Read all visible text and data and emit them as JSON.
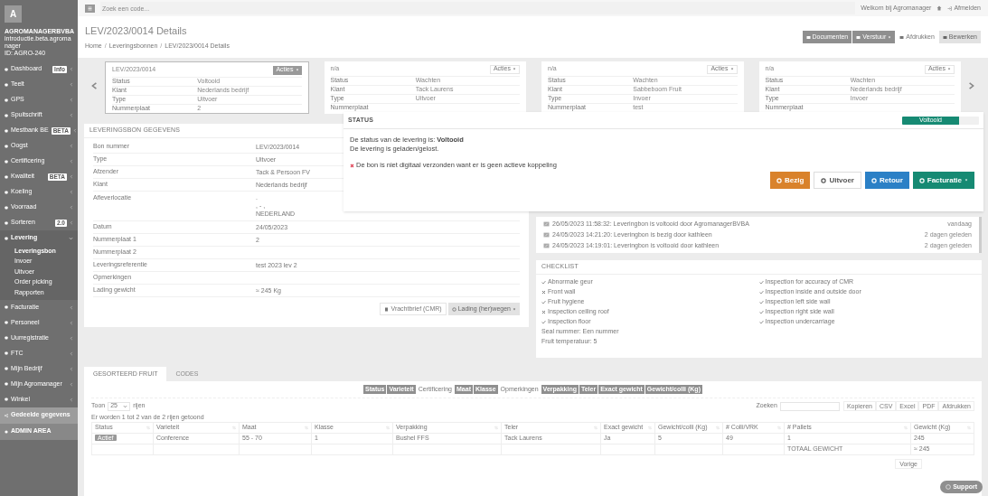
{
  "topbar": {
    "search_placeholder": "Zoek een code...",
    "welcome": "Welkom bij Agromanager",
    "logout": "Afmelden"
  },
  "sidebar": {
    "logo": "A",
    "company": "AGROMANAGERBVBA",
    "subtitle": "introductie.beta.agromanager",
    "id": "ID: AGRO-240",
    "items": [
      {
        "label": "Dashboard",
        "badge": "Info",
        "kind": "item",
        "expanded": false
      },
      {
        "label": "Teelt",
        "kind": "item",
        "expanded": false
      },
      {
        "label": "GPS",
        "kind": "item",
        "expanded": false
      },
      {
        "label": "Spuitschrift",
        "kind": "item",
        "expanded": false
      },
      {
        "label": "Mestbank BE",
        "badge": "BETA",
        "kind": "item",
        "expanded": false
      },
      {
        "label": "Oogst",
        "kind": "item",
        "expanded": false
      },
      {
        "label": "Certificering",
        "kind": "item",
        "expanded": false
      },
      {
        "label": "Kwaliteit",
        "badge": "BETA",
        "kind": "item",
        "expanded": false
      },
      {
        "label": "Koeling",
        "kind": "item",
        "expanded": false
      },
      {
        "label": "Voorraad",
        "kind": "item",
        "expanded": false
      },
      {
        "label": "Sorteren",
        "badge": "2.0",
        "kind": "item",
        "expanded": false
      },
      {
        "label": "Levering",
        "kind": "item",
        "expanded": true,
        "children": [
          {
            "label": "Leveringsbon",
            "selected": true
          },
          {
            "label": "Invoer",
            "selected": false
          },
          {
            "label": "Uitvoer",
            "selected": false
          },
          {
            "label": "Order picking",
            "selected": false
          },
          {
            "label": "Rapporten",
            "selected": false
          }
        ]
      },
      {
        "label": "Facturatie",
        "kind": "item",
        "expanded": false
      },
      {
        "label": "Personeel",
        "kind": "item",
        "expanded": false
      },
      {
        "label": "Uurregistratie",
        "kind": "item",
        "expanded": false
      },
      {
        "label": "FTC",
        "kind": "item",
        "expanded": false
      },
      {
        "label": "Mijn Bedrijf",
        "kind": "item",
        "expanded": false
      },
      {
        "label": "Mijn Agromanager",
        "kind": "item",
        "expanded": false
      },
      {
        "label": "Winkel",
        "kind": "item",
        "expanded": false
      },
      {
        "label": "Gedeelde gegevens",
        "kind": "shared"
      },
      {
        "label": "ADMIN AREA",
        "kind": "admin"
      }
    ]
  },
  "header": {
    "title": "LEV/2023/0014 Details",
    "breadcrumb": [
      "Home",
      "Leveringsbonnen",
      "LEV/2023/0014 Details"
    ],
    "breadcrumb_separator": "/",
    "buttons": [
      {
        "label": "Documenten",
        "kind": "dark",
        "disabled": false
      },
      {
        "label": "Verstuur",
        "kind": "dark",
        "disabled": false,
        "caret": true
      },
      {
        "label": "Afdrukken",
        "kind": "plain",
        "disabled": false
      },
      {
        "label": "Bewerken",
        "kind": "dark",
        "disabled": true
      }
    ]
  },
  "cards": [
    {
      "title": "LEV/2023/0014",
      "selected": true,
      "actions": "Acties",
      "rows": [
        [
          "Status",
          "Voltooid"
        ],
        [
          "Klant",
          "Nederlands bedrijf"
        ],
        [
          "Type",
          "Uitvoer"
        ],
        [
          "Nummerplaat",
          "2"
        ]
      ]
    },
    {
      "title": "n/a",
      "selected": false,
      "actions": "Acties",
      "rows": [
        [
          "Status",
          "Wachten"
        ],
        [
          "Klant",
          "Tack Laurens"
        ],
        [
          "Type",
          "Uitvoer"
        ],
        [
          "Nummerplaat",
          ""
        ]
      ]
    },
    {
      "title": "n/a",
      "selected": false,
      "actions": "Acties",
      "rows": [
        [
          "Status",
          "Wachten"
        ],
        [
          "Klant",
          "Sabbeboom Fruit"
        ],
        [
          "Type",
          "Invoer"
        ],
        [
          "Nummerplaat",
          "test"
        ]
      ]
    },
    {
      "title": "n/a",
      "selected": false,
      "actions": "Acties",
      "rows": [
        [
          "Status",
          "Wachten"
        ],
        [
          "Klant",
          "Nederlands bedrijf"
        ],
        [
          "Type",
          "Invoer"
        ],
        [
          "Nummerplaat",
          ""
        ]
      ]
    }
  ],
  "details": {
    "title": "LEVERINGSBON GEGEVENS",
    "rows": [
      [
        "Bon nummer",
        "LEV/2023/0014"
      ],
      [
        "Type",
        "Uitvoer"
      ],
      [
        "Afzender",
        "Tack & Persoon FV"
      ],
      [
        "Klant",
        "Nederlands bedrijf"
      ],
      [
        "Afleverlocatie",
        ".\n, - ,\nNEDERLAND"
      ],
      [
        "Datum",
        "24/05/2023"
      ],
      [
        "Nummerplaat 1",
        "2"
      ],
      [
        "Nummerplaat 2",
        ""
      ],
      [
        "Leveringsreferentie",
        "test 2023 lev 2"
      ],
      [
        "Opmerkingen",
        ""
      ],
      [
        "Lading gewicht",
        "≈ 245 Kg"
      ]
    ],
    "buttons": [
      {
        "label": "Vrachtbrief (CMR)",
        "disabled": false
      },
      {
        "label": "Lading (her)wegen",
        "disabled": true
      }
    ]
  },
  "status": {
    "title": "STATUS",
    "progress": {
      "label": "Voltooid",
      "level": 0.74
    },
    "line1": "De status van de levering is: **Voltooid**",
    "line2": "De levering is geladen/gelost.",
    "warning": "De bon is niet digitaal verzonden want er is geen actieve koppeling",
    "buttons": [
      {
        "label": "Bezig",
        "kind": "warning"
      },
      {
        "label": "Uitvoer",
        "kind": "plain"
      },
      {
        "label": "Retour",
        "kind": "primary"
      },
      {
        "label": "Facturatie",
        "kind": "success",
        "caret": true
      }
    ]
  },
  "activity": [
    {
      "text": "26/05/2023 11:58:32: Leveringbon is voltooid door AgromanagerBVBA",
      "when": "vandaag"
    },
    {
      "text": "24/05/2023 14:21:20: Leveringbon is bezig door kathleen",
      "when": "2 dagen geleden"
    },
    {
      "text": "24/05/2023 14:19:01: Leveringbon is voltooid door kathleen",
      "when": "2 dagen geleden"
    }
  ],
  "checklist": {
    "title": "CHECKLIST",
    "left": [
      {
        "label": "Abnormale geur",
        "ok": true
      },
      {
        "label": "Front wall",
        "ok": false
      },
      {
        "label": "Fruit hygiene",
        "ok": true
      },
      {
        "label": "Inspection ceiling roof",
        "ok": false
      },
      {
        "label": "Inspection floor",
        "ok": true
      }
    ],
    "right": [
      {
        "label": "Inspection for accuracy of CMR",
        "ok": true
      },
      {
        "label": "Inspection inside and outside door",
        "ok": true
      },
      {
        "label": "Inspection left side wall",
        "ok": true
      },
      {
        "label": "Inspection right side wall",
        "ok": true
      },
      {
        "label": "Inspection undercarriage",
        "ok": true
      }
    ],
    "notes": [
      "Seal nummer: Een nummer",
      "Fruit temperatuur: 5"
    ]
  },
  "bottom": {
    "tabs": [
      {
        "label": "GESORTEERD FRUIT",
        "selected": true
      },
      {
        "label": "CODES",
        "selected": false
      }
    ],
    "toggles": [
      {
        "label": "Status",
        "on": true
      },
      {
        "label": "Varieteit",
        "on": true
      },
      {
        "label": "Certificering",
        "on": false
      },
      {
        "label": "Maat",
        "on": true
      },
      {
        "label": "Klasse",
        "on": true
      },
      {
        "label": "Opmerkingen",
        "on": false
      },
      {
        "label": "Verpakking",
        "on": true
      },
      {
        "label": "Teler",
        "on": true
      },
      {
        "label": "Exact gewicht",
        "on": true
      },
      {
        "label": "Gewicht/colli (Kg)",
        "on": true
      }
    ],
    "show_label": "Toon",
    "page_size": "25",
    "rows_label": "rijen",
    "search_label": "Zoeken",
    "exports": [
      "Kopieren",
      "CSV",
      "Excel",
      "PDF",
      "Afdrukken"
    ],
    "info": "Er worden 1 tot 2 van de 2 rijen getoond",
    "columns": [
      "Status",
      "Varieteit",
      "Maat",
      "Klasse",
      "Verpakking",
      "Teler",
      "Exact gewicht",
      "Gewicht/colli (Kg)",
      "# Colli/VRK",
      "# Pallets",
      "Gewicht (Kg)"
    ],
    "rows": [
      {
        "cells": [
          "Actief",
          "Conference",
          "55 - 70",
          "1",
          "Bushel FFS",
          "Tack Laurens",
          "Ja",
          "5",
          "49",
          "1",
          "245"
        ]
      },
      {
        "cells": [
          "",
          "",
          "",
          "",
          "",
          "",
          "",
          "",
          "",
          "TOTAAL GEWICHT",
          "≈ 245"
        ]
      }
    ],
    "prev": "Vorige",
    "support": "Support"
  }
}
